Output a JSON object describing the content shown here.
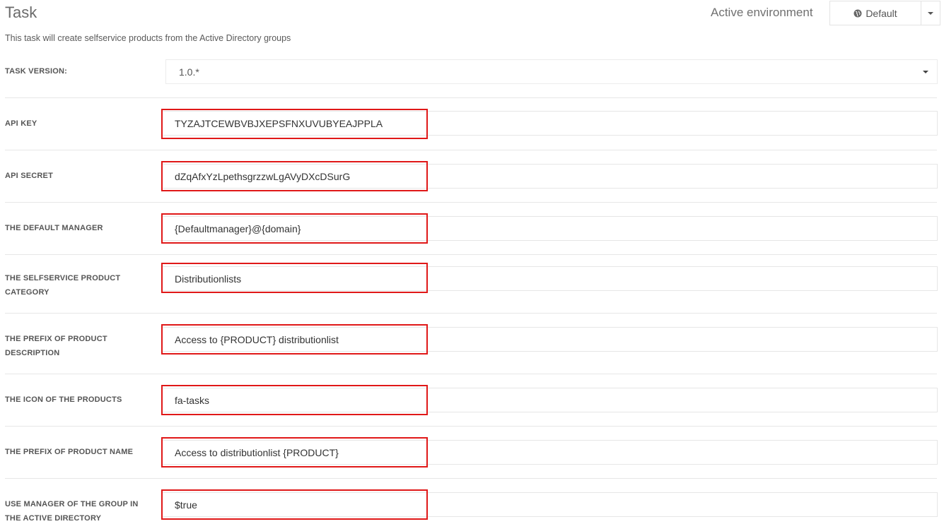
{
  "header": {
    "title": "Task",
    "subtitle": "This task will create selfservice products from the Active Directory groups",
    "environment_label": "Active environment",
    "environment_value": "Default",
    "environment_icon": "globe-icon"
  },
  "task_version": {
    "label": "TASK VERSION:",
    "value": "1.0.*"
  },
  "fields": [
    {
      "label": "API KEY",
      "value": "TYZAJTCEWBVBJXEPSFNXUVUBYEAJPPLA"
    },
    {
      "label": "API SECRET",
      "value": "dZqAfxYzLpethsgrzzwLgAVyDXcDSurG"
    },
    {
      "label": "THE DEFAULT MANAGER",
      "value": "{Defaultmanager}@{domain}"
    },
    {
      "label": "THE SELFSERVICE PRODUCT CATEGORY",
      "value": "Distributionlists"
    },
    {
      "label": "THE PREFIX OF PRODUCT DESCRIPTION",
      "value": "Access to {PRODUCT} distributionlist"
    },
    {
      "label": "THE ICON OF THE PRODUCTS",
      "value": "fa-tasks"
    },
    {
      "label": "THE PREFIX OF PRODUCT NAME",
      "value": "Access to distributionlist {PRODUCT}"
    },
    {
      "label": "USE MANAGER OF THE GROUP IN THE ACTIVE DIRECTORY",
      "value": "$true"
    }
  ],
  "colors": {
    "highlight": "#e01818",
    "border": "#e6e6e6"
  }
}
